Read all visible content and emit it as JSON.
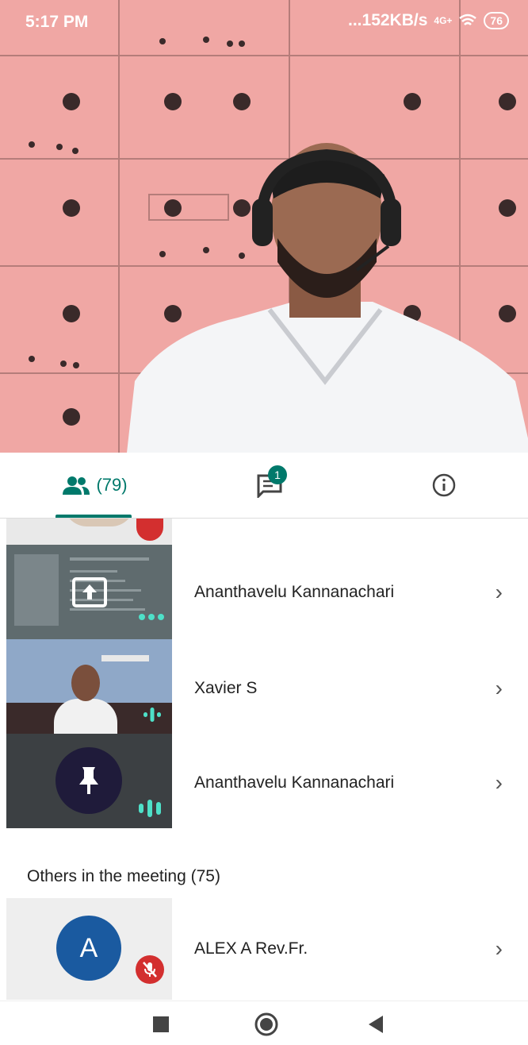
{
  "status_bar": {
    "time": "5:17 PM",
    "network_speed": "...152KB/s",
    "signal": "4G+",
    "battery": "76"
  },
  "tabs": {
    "people_count": "(79)",
    "chat_badge": "1"
  },
  "pinned_participants": [
    {
      "name": "Ananthavelu Kannanachari"
    },
    {
      "name": "Xavier S"
    },
    {
      "name": "Ananthavelu Kannanachari"
    }
  ],
  "others": {
    "section_label": "Others in the meeting (75)",
    "participants": [
      {
        "name": "ALEX A Rev.Fr.",
        "avatar_letter": "A"
      }
    ]
  },
  "colors": {
    "accent": "#00796b",
    "muted_red": "#d32f2f",
    "avatar_blue": "#1a5aa0"
  }
}
